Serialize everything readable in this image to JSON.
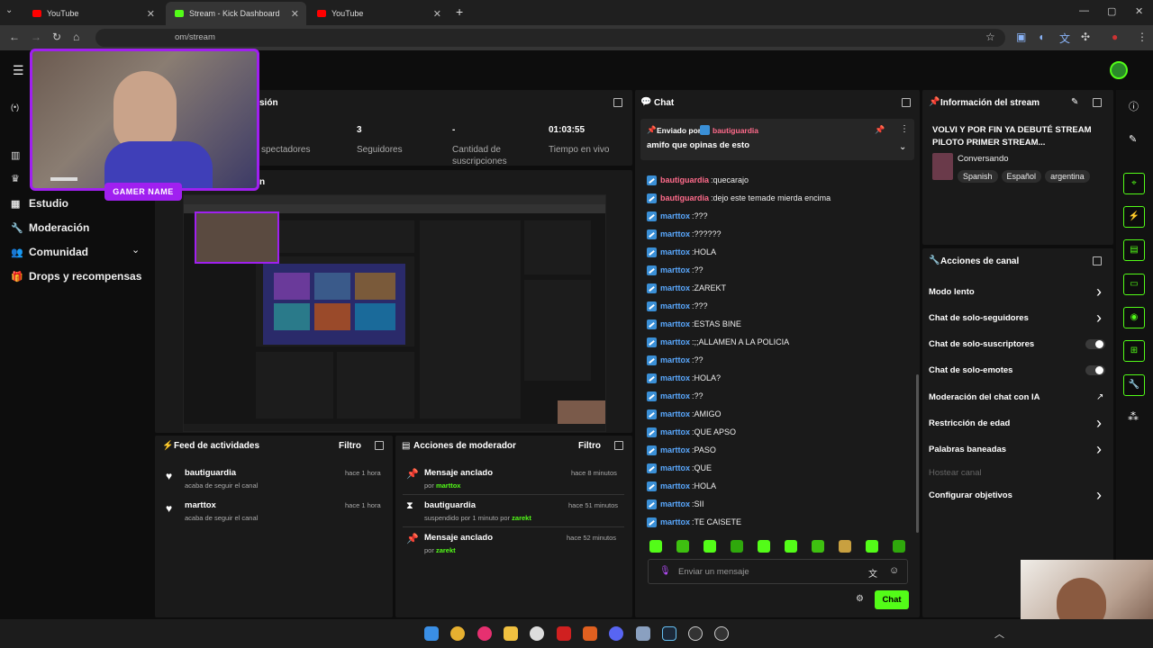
{
  "browser": {
    "tabs": [
      {
        "title": "YouTube",
        "active": false
      },
      {
        "title": "Stream - Kick Dashboard",
        "active": true
      },
      {
        "title": "YouTube",
        "active": false
      }
    ],
    "url": "om/stream"
  },
  "sidebar": {
    "items": [
      {
        "label": "Estudio",
        "icon": "grid-icon"
      },
      {
        "label": "Moderación",
        "icon": "wrench-icon"
      },
      {
        "label": "Comunidad",
        "icon": "users-icon"
      },
      {
        "label": "Drops y recompensas",
        "icon": "gift-icon"
      }
    ]
  },
  "webcam": {
    "label": "GAMER NAME"
  },
  "session": {
    "title_fragment": "sión",
    "preview_fragment": "n",
    "stats": [
      {
        "value": "",
        "label": "spectadores"
      },
      {
        "value": "3",
        "label": "Seguidores"
      },
      {
        "value": "-",
        "label": "Cantidad de suscripciones"
      },
      {
        "value": "01:03:55",
        "label": "Tiempo en vivo"
      }
    ]
  },
  "chat": {
    "title": "Chat",
    "pinned": {
      "sent_by_label": "Enviado por",
      "user": "bautiguardia",
      "message": "amifo que opinas de esto"
    },
    "messages": [
      {
        "user": "bautiguardia",
        "text": "quecarajo",
        "color": "#ff6b8b"
      },
      {
        "user": "bautiguardia",
        "text": "dejo este temade mierda encima",
        "color": "#ff6b8b"
      },
      {
        "user": "marttox",
        "text": "???",
        "color": "#5aa9ff"
      },
      {
        "user": "marttox",
        "text": "??????",
        "color": "#5aa9ff"
      },
      {
        "user": "marttox",
        "text": "HOLA",
        "color": "#5aa9ff"
      },
      {
        "user": "marttox",
        "text": "??",
        "color": "#5aa9ff"
      },
      {
        "user": "marttox",
        "text": "ZAREKT",
        "color": "#5aa9ff"
      },
      {
        "user": "marttox",
        "text": "???",
        "color": "#5aa9ff"
      },
      {
        "user": "marttox",
        "text": "ESTAS BINE",
        "color": "#5aa9ff"
      },
      {
        "user": "marttox",
        "text": ";;ALLAMEN A LA POLICIA",
        "color": "#5aa9ff"
      },
      {
        "user": "marttox",
        "text": "??",
        "color": "#5aa9ff"
      },
      {
        "user": "marttox",
        "text": "HOLA?",
        "color": "#5aa9ff"
      },
      {
        "user": "marttox",
        "text": "??",
        "color": "#5aa9ff"
      },
      {
        "user": "marttox",
        "text": "AMIGO",
        "color": "#5aa9ff"
      },
      {
        "user": "marttox",
        "text": "QUE APSO",
        "color": "#5aa9ff"
      },
      {
        "user": "marttox",
        "text": "PASO",
        "color": "#5aa9ff"
      },
      {
        "user": "marttox",
        "text": "QUE",
        "color": "#5aa9ff"
      },
      {
        "user": "marttox",
        "text": "HOLA",
        "color": "#5aa9ff"
      },
      {
        "user": "marttox",
        "text": "SII",
        "color": "#5aa9ff"
      },
      {
        "user": "marttox",
        "text": "TE CAISETE",
        "color": "#5aa9ff"
      }
    ],
    "input_placeholder": "Enviar un mensaje",
    "send_label": "Chat"
  },
  "stream_info": {
    "title": "Información del stream",
    "stream_title": "VOLVI Y POR FIN YA DEBUTÉ STREAM PILOTO PRIMER STREAM...",
    "category": "Conversando",
    "tags": [
      "Spanish",
      "Español",
      "argentina"
    ]
  },
  "channel_actions": {
    "title": "Acciones de canal",
    "items": [
      {
        "label": "Modo lento",
        "control": "chevron"
      },
      {
        "label": "Chat de solo-seguidores",
        "control": "chevron"
      },
      {
        "label": "Chat de solo-suscriptores",
        "control": "toggle"
      },
      {
        "label": "Chat de solo-emotes",
        "control": "toggle"
      },
      {
        "label": "Moderación del chat con IA",
        "control": "external"
      },
      {
        "label": "Restricción de edad",
        "control": "chevron"
      },
      {
        "label": "Palabras baneadas",
        "control": "chevron"
      },
      {
        "label": "Hostear canal",
        "control": "none",
        "disabled": true
      },
      {
        "label": "Configurar objetivos",
        "control": "chevron"
      }
    ]
  },
  "activity_feed": {
    "title": "Feed de actividades",
    "filter_label": "Filtro",
    "items": [
      {
        "user": "bautiguardia",
        "sub": "acaba de seguir el canal",
        "time": "hace 1 hora"
      },
      {
        "user": "marttox",
        "sub": "acaba de seguir el canal",
        "time": "hace 1 hora"
      }
    ]
  },
  "mod_actions": {
    "title": "Acciones de moderador",
    "filter_label": "Filtro",
    "items": [
      {
        "action": "Mensaje anclado",
        "sub_prefix": "por",
        "actor": "marttox",
        "time": "hace 8 minutos",
        "icon": "pin-icon"
      },
      {
        "action": "bautiguardia",
        "sub_prefix": "suspendido por 1 minuto por",
        "actor": "zarekt",
        "time": "hace 51 minutos",
        "icon": "hourglass-icon"
      },
      {
        "action": "Mensaje anclado",
        "sub_prefix": "por",
        "actor": "zarekt",
        "time": "hace 52 minutos",
        "icon": "pin-icon"
      }
    ]
  },
  "colors": {
    "accent": "#53fc18",
    "panel": "#1a1a1a",
    "bg": "#0d0d0d",
    "webcam_border": "#a020f0"
  }
}
